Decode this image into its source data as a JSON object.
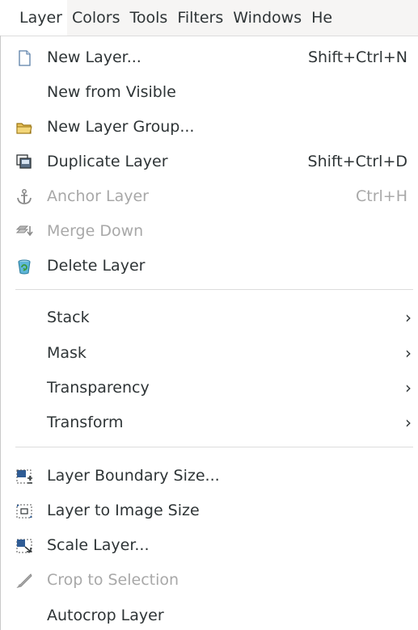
{
  "menubar": {
    "items": [
      {
        "label": "Layer",
        "active": true
      },
      {
        "label": "Colors"
      },
      {
        "label": "Tools"
      },
      {
        "label": "Filters"
      },
      {
        "label": "Windows"
      },
      {
        "label": "He"
      }
    ]
  },
  "menu": {
    "new_layer": {
      "label": "New Layer...",
      "shortcut": "Shift+Ctrl+N",
      "icon": "new-layer-icon",
      "enabled": true
    },
    "new_from_visible": {
      "label": "New from Visible",
      "enabled": true
    },
    "new_layer_group": {
      "label": "New Layer Group...",
      "icon": "folder-icon",
      "enabled": true
    },
    "duplicate_layer": {
      "label": "Duplicate Layer",
      "shortcut": "Shift+Ctrl+D",
      "icon": "duplicate-icon",
      "enabled": true
    },
    "anchor_layer": {
      "label": "Anchor Layer",
      "shortcut": "Ctrl+H",
      "icon": "anchor-icon",
      "enabled": false
    },
    "merge_down": {
      "label": "Merge Down",
      "icon": "merge-down-icon",
      "enabled": false
    },
    "delete_layer": {
      "label": "Delete Layer",
      "icon": "trash-icon",
      "enabled": true
    },
    "stack": {
      "label": "Stack",
      "submenu": true
    },
    "mask": {
      "label": "Mask",
      "submenu": true
    },
    "transparency": {
      "label": "Transparency",
      "submenu": true
    },
    "transform": {
      "label": "Transform",
      "submenu": true
    },
    "layer_boundary_size": {
      "label": "Layer Boundary Size...",
      "icon": "boundary-size-icon",
      "enabled": true
    },
    "layer_to_image_size": {
      "label": "Layer to Image Size",
      "icon": "to-image-size-icon",
      "enabled": true
    },
    "scale_layer": {
      "label": "Scale Layer...",
      "icon": "scale-icon",
      "enabled": true
    },
    "crop_to_selection": {
      "label": "Crop to Selection",
      "icon": "crop-icon",
      "enabled": false
    },
    "autocrop_layer": {
      "label": "Autocrop Layer",
      "enabled": true
    },
    "submenu_arrow": "›"
  },
  "colors": {
    "text": "#2e3436",
    "disabled_text": "#a8a8a8",
    "separator": "#dcdcdc",
    "menubar_bg": "#f6f5f4"
  }
}
